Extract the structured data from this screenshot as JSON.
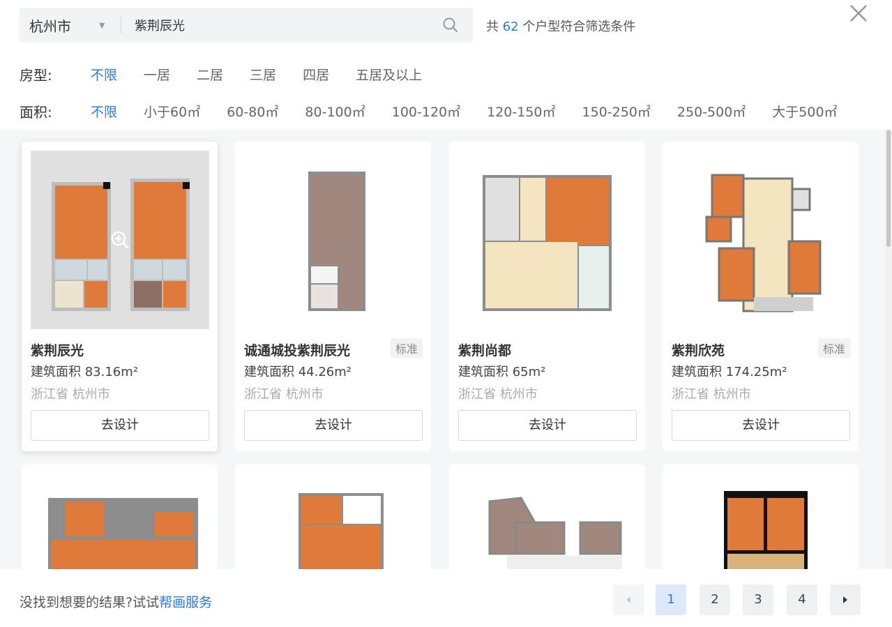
{
  "search": {
    "city": "杭州市",
    "query": "紫荆辰光"
  },
  "result": {
    "prefix": "共",
    "count": "62",
    "suffix": "个户型符合筛选条件"
  },
  "filters": {
    "room": {
      "label": "房型:",
      "options": [
        "不限",
        "一居",
        "二居",
        "三居",
        "四居",
        "五居及以上"
      ],
      "active": 0
    },
    "area": {
      "label": "面积:",
      "options": [
        "不限",
        "小于60㎡",
        "60-80㎡",
        "80-100㎡",
        "100-120㎡",
        "120-150㎡",
        "150-250㎡",
        "250-500㎡",
        "大于500㎡"
      ],
      "active": 0
    }
  },
  "cards": [
    {
      "title": "紫荆辰光",
      "tag": "",
      "area": "建筑面积 83.16m²",
      "location": "浙江省 杭州市",
      "button": "去设计"
    },
    {
      "title": "诚通城投紫荆辰光",
      "tag": "标准",
      "area": "建筑面积 44.26m²",
      "location": "浙江省 杭州市",
      "button": "去设计"
    },
    {
      "title": "紫荆尚都",
      "tag": "",
      "area": "建筑面积 65m²",
      "location": "浙江省 杭州市",
      "button": "去设计"
    },
    {
      "title": "紫荆欣苑",
      "tag": "标准",
      "area": "建筑面积 174.25m²",
      "location": "浙江省 杭州市",
      "button": "去设计"
    }
  ],
  "footer": {
    "text": "没找到想要的结果?试试",
    "link": "帮画服务"
  },
  "pagination": {
    "pages": [
      "1",
      "2",
      "3",
      "4"
    ],
    "current": "1"
  },
  "colors": {
    "accent": "#2a7ae2",
    "floor_orange": "#e07a3a",
    "wall": "#777777"
  }
}
